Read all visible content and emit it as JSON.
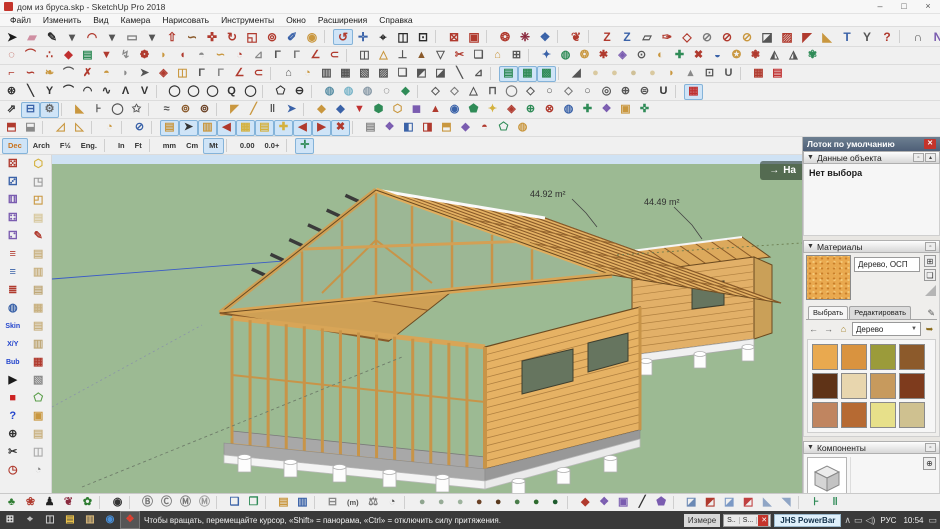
{
  "window": {
    "title": "дом из бруса.skp - SketchUp Pro 2018",
    "min": "–",
    "max": "□",
    "close": "×"
  },
  "menu": [
    "Файл",
    "Изменить",
    "Вид",
    "Камера",
    "Нарисовать",
    "Инструменты",
    "Окно",
    "Расширения",
    "Справка"
  ],
  "toolbars": {
    "r1": [
      "➤|#1a1a1a|select-tool",
      "▰|#cf8fa2|eraser-tool",
      "✎|#2a2a2a|line-tool",
      "▾|#555|line-dropdown",
      "◠|#b03a2e|arc-tool",
      "▾|#555|arc-dropdown",
      "▭|#7a7a7a|rectangle-tool",
      "▾|#555|shapes-dropdown",
      "⇧|#b03a2e|pushpull-tool",
      "∽|#8a5a2b|followme-tool",
      "✜|#b03a2e|move-tool",
      "↻|#b03a2e|rotate-tool",
      "◱|#b03a2e|scale-tool",
      "⊚|#b03a2e|offset-tool",
      "✐|#3a62a8|tape-measure-tool",
      "◉|#c9973f|paint-bucket-tool",
      "sep",
      "↺|#b03a2e|orbit-tool|hl",
      "✛|#3a62a8|pan-tool",
      "⌖|#2a2a2a|zoom-tool",
      "◫|#2a2a2a|zoom-window-tool",
      "⊡|#2a2a2a|zoom-extents-tool",
      "sep",
      "⊠|#b03a2e|section-plane-tool",
      "▣|#b03a2e|section-fill-tool",
      "sep",
      "❂|#b03a2e|extension-tool",
      "❈|#8a2a3e|extension-tool",
      "❖|#3a62a8|extension-tool",
      "sep",
      "❦|#b03a2e|extension-tool",
      "sep",
      "Z|#b03a2e|extension-tool",
      "Z|#3a62a8|extension-tool",
      "▱|#555|extension-tool",
      "✑|#b03a2e|extension-tool",
      "◇|#b03a2e|extension-tool",
      "⊘|#7a7a7a|extension-tool",
      "⊘|#b03a2e|extension-tool",
      "⊘|#c9973f|extension-tool",
      "◪|#555|extension-tool",
      "▨|#b03a2e|extension-tool",
      "◤|#b03a2e|extension-tool",
      "◣|#c9973f|extension-tool",
      "T|#3a62a8|extension-tool",
      "Y|#555|extension-tool",
      "?|#b03a2e|help-tool",
      "sep",
      "∩|#555|bezier-tool",
      "N|#7a5cb0|bezier-tool",
      "W|#b03a2e|bezier-tool",
      "N|#555|bezier-tool",
      "I|#3a62a8|bezier-tool",
      "Γ|#555|bezier-tool",
      "◻|#555|bezier-tool",
      "◎|#7a5cb0|bezier-tool",
      "Γ|#b03a2e|bezier-tool"
    ],
    "r2": [
      "◌|#b03a2e|ext-tool",
      "⌒|#b03a2e|ext-tool",
      "∴|#b03a2e|ext-tool",
      "◆|#c03030|ext-tool",
      "▤|#2f8b57|ext-tool",
      "▼|#b03a2e|ext-tool",
      "↯|#8a8a8a|ext-tool",
      "❁|#b03a2e|ext-tool",
      "◗|#c9973f|ext-tool",
      "◖|#b03a2e|ext-tool",
      "◓|#8a8a8a|ext-tool",
      "∽|#c9973f|ext-tool",
      "◔|#b03a2e|ext-tool",
      "⊿|#8a8a8a|ext-tool",
      "Γ|#555|ext-tool",
      "Γ|#777|ext-tool",
      "∠|#b03a2e|ext-tool",
      "⊂|#b03a2e|ext-tool",
      "sep",
      "◫|#555|ext-tool",
      "△|#c9973f|ext-tool",
      "⊥|#555|ext-tool",
      "▲|#8a5a2b|ext-tool",
      "▽|#555|ext-tool",
      "✂|#b03a2e|ext-tool",
      "❏|#555|ext-tool",
      "⌂|#c9973f|ext-tool",
      "⊞|#555|ext-tool",
      "sep",
      "✦|#3a62a8|ext-tool",
      "◍|#2f8b57|ext-tool",
      "❂|#c9973f|ext-tool",
      "✱|#b03a2e|ext-tool",
      "◈|#7a5cb0|ext-tool",
      "⊙|#555|ext-tool",
      "◐|#c9973f|ext-tool",
      "✚|#2f8b57|ext-tool",
      "✖|#b03a2e|ext-tool",
      "◒|#3a62a8|ext-tool",
      "✪|#c9973f|ext-tool",
      "❃|#b03a2e|ext-tool",
      "◭|#555|ext-tool",
      "◮|#555|ext-tool",
      "✾|#2f8b57|ext-tool"
    ],
    "r3": [
      "⌐|#b03a2e|ext-tool",
      "∽|#b03a2e|ext-tool",
      "❧|#c9973f|ext-tool",
      "⌒|#555|ext-tool",
      "✗|#b03a2e|ext-tool",
      "◓|#c9973f|ext-tool",
      "◗|#8a8a8a|ext-tool",
      "➤|#555|ext-tool",
      "◈|#b03a2e|ext-tool",
      "◫|#c9973f|ext-tool",
      "Γ|#555|ext-tool",
      "Γ|#888|ext-tool",
      "∠|#b03a2e|ext-tool",
      "⊂|#b03a2e|ext-tool",
      "sep",
      "⌂|#555|ext-tool",
      "◔|#c9973f|ext-tool",
      "▥|#555|ext-tool",
      "▦|#555|ext-tool",
      "▧|#555|ext-tool",
      "▨|#555|ext-tool",
      "❏|#555|ext-tool",
      "◩|#555|ext-tool",
      "◪|#555|ext-tool",
      "╲|#555|ext-tool",
      "⊿|#555|ext-tool",
      "sep",
      "▤|#2f8b57|ext-tool|hl",
      "▦|#2f8b57|ext-tool|hl",
      "▩|#2f8b57|ext-tool|hl",
      "sep",
      "◢|#555|ext-tool",
      "●|#d9c9a0|ext-tool",
      "●|#d9c9a0|ext-tool",
      "●|#cfc098|ext-tool",
      "●|#d9c9a0|ext-tool",
      "◗|#c9973f|ext-tool",
      "▴|#8a8a8a|ext-tool",
      "⊡|#555|ext-tool",
      "U|#555|ext-tool",
      "sep",
      "▦|#b03a2e|brick-tool",
      "▤|#c03030|brick-tool"
    ],
    "r4": [
      "⊛|#333|weld-tool",
      "╲|#333|curve-tool",
      "Y|#333|curve-tool",
      "⌒|#333|curve-tool",
      "◠|#333|curve-tool",
      "∿|#333|curve-tool",
      "Λ|#333|curve-tool",
      "V|#333|curve-tool",
      "sep",
      "◯|#333|circle-tool",
      "◯|#333|circle-tool",
      "◯|#333|circle-tool",
      "Q|#333|circle-tool",
      "◯|#333|circle-tool",
      "sep",
      "⬠|#333|polygon-tool",
      "⊖|#333|polygon-tool",
      "sep",
      "◍|#5a8fa5|sphere-tool",
      "◍|#7ab5c9|sphere-tool",
      "◍|#8a9ba8|sphere-tool",
      "◌|#333|sphere-tool",
      "◆|#2f8b57|sphere-tool",
      "sep",
      "◇|#555|shape-tool",
      "◇|#777|shape-tool",
      "△|#555|shape-tool",
      "⊓|#555|shape-tool",
      "◯|#777|shape-tool",
      "◇|#555|shape-tool",
      "○|#555|shape-tool",
      "◇|#777|shape-tool",
      "○|#555|shape-tool",
      "◎|#555|shape-tool",
      "⊕|#555|shape-tool",
      "⊜|#555|shape-tool",
      "U|#333|shape-tool",
      "sep",
      "▦|#c03030|brick-tool|hl"
    ],
    "r5": [
      "⇗|#333|ext-tool",
      "⊟|#3a62a8|ext-tool|hl",
      "⚙|#666|settings-tool|hl",
      "sep",
      "◣|#c9973f|ext-tool",
      "⊦|#555|ext-tool",
      "◯|#555|ext-tool",
      "✩|#555|ext-tool",
      "sep",
      "≈|#555|ext-tool",
      "⊚|#8a5a2b|ext-tool",
      "⊚|#6b4226|ext-tool",
      "sep",
      "◤|#c9973f|ext-tool",
      "╱|#c9973f|ext-tool",
      "‖|#555|ext-tool",
      "➤|#3a62a8|ext-tool",
      "sep",
      "◆|#c9973f|ext-tool",
      "◆|#3a62a8|ext-tool",
      "▼|#c03030|ext-tool",
      "⬢|#2f8b57|ext-tool",
      "⬡|#c9973f|ext-tool",
      "◼|#7a5cb0|ext-tool",
      "▲|#b03a2e|ext-tool",
      "◉|#3a62a8|ext-tool",
      "⬟|#2f8b57|ext-tool",
      "✦|#d4b13e|ext-tool",
      "◈|#b03a2e|ext-tool",
      "⊕|#2f8b57|ext-tool",
      "⊗|#b03a2e|ext-tool",
      "◍|#3a62a8|ext-tool",
      "✚|#2f8b57|ext-tool",
      "❖|#7a5cb0|ext-tool",
      "▣|#c9973f|ext-tool",
      "✜|#2f8b57|ext-tool"
    ],
    "r6": [
      "⬒|#b03a2e|layer-tool",
      "⬓|#8a8a8a|layer-tool",
      "sep",
      "◿|#c9973f|layer-tool",
      "◺|#c9973f|layer-tool",
      "sep",
      "◔|#c9973f|layer-tool",
      "sep",
      "⊘|#3a62a8|layer-tool",
      "sep",
      "▤|#c9973f|layer-tool|hl",
      "➤|#333|layer-tool|hl",
      "▥|#c9973f|layer-tool|hl",
      "◀|#b03a2e|layer-tool|hl",
      "▦|#d4b13e|layer-tool|hl",
      "▤|#d4b13e|layer-tool|hl",
      "✚|#d4b13e|layer-tool|hl",
      "◀|#b03a2e|layer-tool|hl",
      "▶|#b03a2e|layer-tool|hl",
      "✖|#b03a2e|layer-tool|hl",
      "sep",
      "▤|#8a8a8a|layer-tool",
      "❖|#7a5cb0|layer-tool",
      "◧|#3a62a8|layer-tool",
      "◨|#b03a2e|layer-tool",
      "⬒|#c9973f|layer-tool",
      "◆|#7a5cb0|layer-tool",
      "◓|#b03a2e|layer-tool",
      "⬠|#2f8b57|layer-tool",
      "◍|#c9973f|layer-tool"
    ],
    "units": [
      "Dec|#c9731e|unit-dec|hl",
      "Arch|#333|unit-arch",
      "F½|#333|unit-fraction",
      "Eng.|#333|unit-eng",
      "sep",
      "In|#333|unit-inch",
      "Ft|#333|unit-feet",
      "sep",
      "mm|#333|unit-mm",
      "Cm|#333|unit-cm",
      "Mt|#333|unit-meter|hl",
      "sep",
      "0.00|#333|precision-low",
      "0.0+|#333|precision-high",
      "sep",
      "✛|#2f8b57|axes-toggle|hl"
    ],
    "left1": [
      "⚄|#b03a2e|dice-tool",
      "⚂|#3a62a8|dice-tool",
      "⚅|#7a5cb0|dice-tool",
      "⚃|#7a5cb0|dice-tool",
      "⚁|#7a5cb0|dice-tool",
      "≡|#b03a2e|layers-stack-tool",
      "≡|#3a62a8|layers-stack-tool",
      "≣|#b03a2e|layers-stack-tool",
      "◍|#3a62a8|globe-tool",
      "Skin|#2244cc|skin-tool",
      "X/Y|#2244cc|xy-tool",
      "Bub|#2244cc|bubble-tool",
      "▶|#1a1a1a|play-button",
      "■|#cc2222|stop-button",
      "?|#2244cc|help-tool",
      "⊕|#333|compass-tool",
      "✂|#333|scissors-tool",
      "◷|#b03a2e|clock-tool"
    ],
    "left2": [
      "⬡|#d4b13e|box-tool",
      "◳|#999|cube-tool",
      "◰|#c9973f|cube-tool",
      "▤|#d8c9a0|sheet-tool",
      "✎|#b03a2e|sketch-tool",
      "▤|#c9b282|sheet-tool",
      "▥|#c9b282|sheet-tool",
      "▤|#bfa878|sheet-tool",
      "▦|#c9b282|sheet-tool",
      "▤|#c9b282|sheet-tool",
      "▥|#bfa878|sheet-tool",
      "▦|#b03a2e|map-tool",
      "▧|#888|hatch-tool",
      "⬠|#5a9e4a|terrain-tool",
      "▣|#c9973f|frame-tool",
      "▤|#c9b282|sheet-tool",
      "◫|#aaa|panel-tool",
      "◔|#888|dial-tool"
    ],
    "bottom": [
      "♣|#2f7d32|tree-icon",
      "❀|#b03a2e|flower-icon",
      "♟|#222|figure-icon",
      "❦|#8a2a3e|figure-icon",
      "✿|#2f7d32|plant-icon",
      "sep",
      "◉|#333|compass-icon",
      "sep",
      "Ⓑ|#777|doc-b-icon",
      "Ⓒ|#777|doc-c-icon",
      "Ⓜ|#777|doc-m-icon",
      "Ⓜ|#999|doc-m-icon",
      "sep",
      "❏|#3a62a8|layout-icon",
      "❐|#2f8b57|layout-icon",
      "sep",
      "▤|#c9973f|folder-icon",
      "▥|#3a62a8|folder-icon",
      "sep",
      "⊟|#888|doc-icon",
      "(m)|#555|units-chip",
      "⚖|#777|weight-icon",
      "◔|#555|gauge-icon",
      "sep",
      "●|#8fa58f|material-sphere",
      "●|#96ab96|material-sphere",
      "●|#9db39d|material-sphere",
      "●|#6b4226|material-sphere",
      "●|#5a3a1e|material-sphere",
      "●|#4a7d4a|material-sphere",
      "●|#2e6b2e|material-sphere",
      "●|#1e5b2e|material-sphere",
      "sep",
      "◆|#b03a2e|car-icon",
      "❖|#7a5cb0|ext-icon",
      "▣|#7a5cb0|ext-icon",
      "╱|#333|line-icon",
      "⬟|#7a5cb0|prism-icon",
      "sep",
      "◪|#6b89b5|terrain-stamp-icon",
      "◩|#b03a2e|terrain-stamp-icon",
      "◪|#7b99c5|terrain-stamp-icon",
      "◩|#c04040|terrain-stamp-icon",
      "◣|#8fa5c5|terrain-stamp-icon",
      "◥|#8fa5c5|terrain-stamp-icon",
      "sep",
      "⊦|#2f8b57|spacing-icon",
      "‖|#2f8b57|spacing-icon"
    ]
  },
  "viewport": {
    "area1": "44.92 m²",
    "area2": "44.49 m²",
    "start_arrow": "→",
    "start_label": "На"
  },
  "tray": {
    "title": "Лоток по умолчанию",
    "close": "✕",
    "arrow": "▼",
    "entity": {
      "header": "Данные объекта",
      "empty": "Нет выбора"
    },
    "materials": {
      "header": "Материалы",
      "current": "Дерево, ОСП",
      "tab_select": "Выбрать",
      "tab_edit": "Редактировать",
      "dropdown": "Дерево",
      "swatches": [
        "#e9a94f",
        "#d9933f",
        "#9b9b3a",
        "#8c5a2b",
        "#5f3317",
        "#e8d6ae",
        "#c79a5d",
        "#7e3b1d",
        "#c08560",
        "#b66a33",
        "#e7e08a",
        "#cfc190"
      ]
    },
    "components": {
      "header": "Компоненты"
    }
  },
  "taskbar": {
    "icons": [
      "⊞|#e8e8e8|start-button",
      "⌖|#ccc|search-icon",
      "◫|#ccc|task-view-icon",
      "▤|#e8c04a|explorer-icon",
      "▥|#d8b87a|mail-icon",
      "◉|#4a90d9|chrome-icon",
      "❖|#e04030|sketchup-taskbar-icon|hl"
    ],
    "status": "Чтобы вращать, перемещайте курсор, «Shift» = панорама, «Ctrl» = отключить силу притяжения.",
    "measure": "Измере",
    "win1": "S..",
    "win2": "S...",
    "tooltip": "JHS PowerBar",
    "chevron": "∧",
    "network": "▭",
    "volume": "◁)",
    "lang": "РУС",
    "time": "10:54"
  }
}
